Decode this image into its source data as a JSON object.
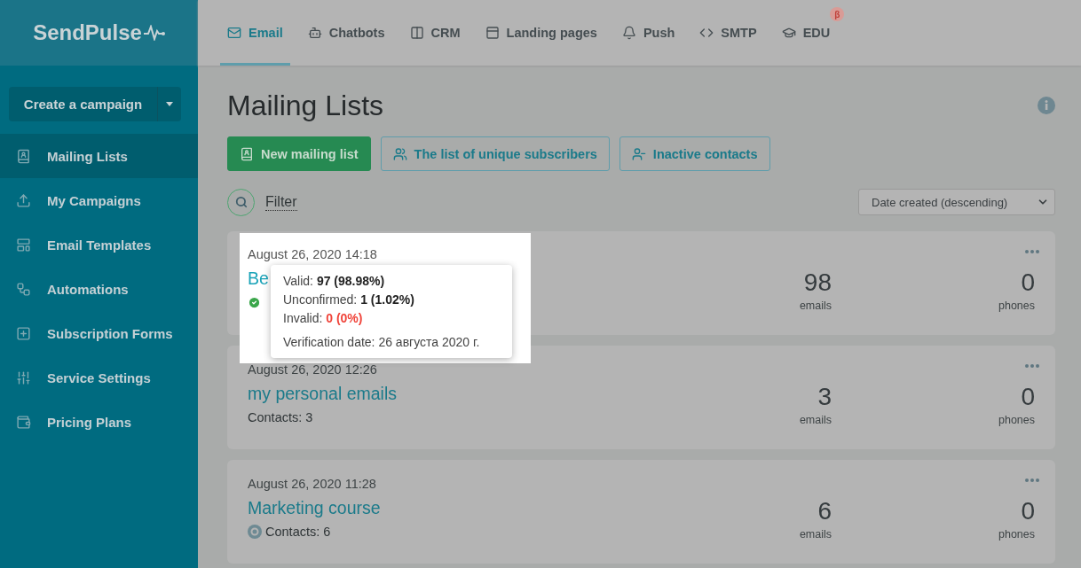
{
  "logo": "SendPulse",
  "create_button": {
    "label": "Create a campaign"
  },
  "sidebar": {
    "items": [
      {
        "label": "Mailing Lists",
        "selected": true
      },
      {
        "label": "My Campaigns",
        "selected": false
      },
      {
        "label": "Email Templates",
        "selected": false
      },
      {
        "label": "Automations",
        "selected": false
      },
      {
        "label": "Subscription Forms",
        "selected": false
      },
      {
        "label": "Service Settings",
        "selected": false
      },
      {
        "label": "Pricing Plans",
        "selected": false
      }
    ]
  },
  "nav": {
    "tabs": [
      {
        "label": "Email",
        "selected": true
      },
      {
        "label": "Chatbots",
        "selected": false
      },
      {
        "label": "CRM",
        "selected": false
      },
      {
        "label": "Landing pages",
        "selected": false
      },
      {
        "label": "Push",
        "selected": false
      },
      {
        "label": "SMTP",
        "selected": false
      },
      {
        "label": "EDU",
        "selected": false,
        "badge": "β"
      }
    ]
  },
  "page_title": "Mailing Lists",
  "actions": [
    {
      "label": "New mailing list",
      "kind": "primary"
    },
    {
      "label": "The list of unique subscribers",
      "kind": "outline"
    },
    {
      "label": "Inactive contacts",
      "kind": "outline"
    }
  ],
  "filter": {
    "label": "Filter"
  },
  "sort": {
    "value": "Date created (descending)"
  },
  "lists": [
    {
      "date": "August 26, 2020 14:18",
      "name": "Be",
      "kind": "verified",
      "emails": "98",
      "emails_label": "emails",
      "phones": "0",
      "phones_label": "phones",
      "highlighted": true
    },
    {
      "date": "August 26, 2020 12:26",
      "name": "my personal emails",
      "contacts": "Contacts: 3",
      "kind": "plain",
      "emails": "3",
      "emails_label": "emails",
      "phones": "0",
      "phones_label": "phones",
      "highlighted": false
    },
    {
      "date": "August 26, 2020 11:28",
      "name": "Marketing course",
      "contacts": "Contacts: 6",
      "kind": "pending",
      "emails": "6",
      "emails_label": "emails",
      "phones": "0",
      "phones_label": "phones",
      "highlighted": false
    }
  ],
  "tooltip": {
    "lines": [
      {
        "label": "Valid:",
        "value": "97 (98.98%)",
        "error": false
      },
      {
        "label": "Unconfirmed:",
        "value": "1 (1.02%)",
        "error": false
      },
      {
        "label": "Invalid:",
        "value": "0 (0%)",
        "error": true
      }
    ],
    "verification": "Verification date: 26 августа 2020 г."
  }
}
